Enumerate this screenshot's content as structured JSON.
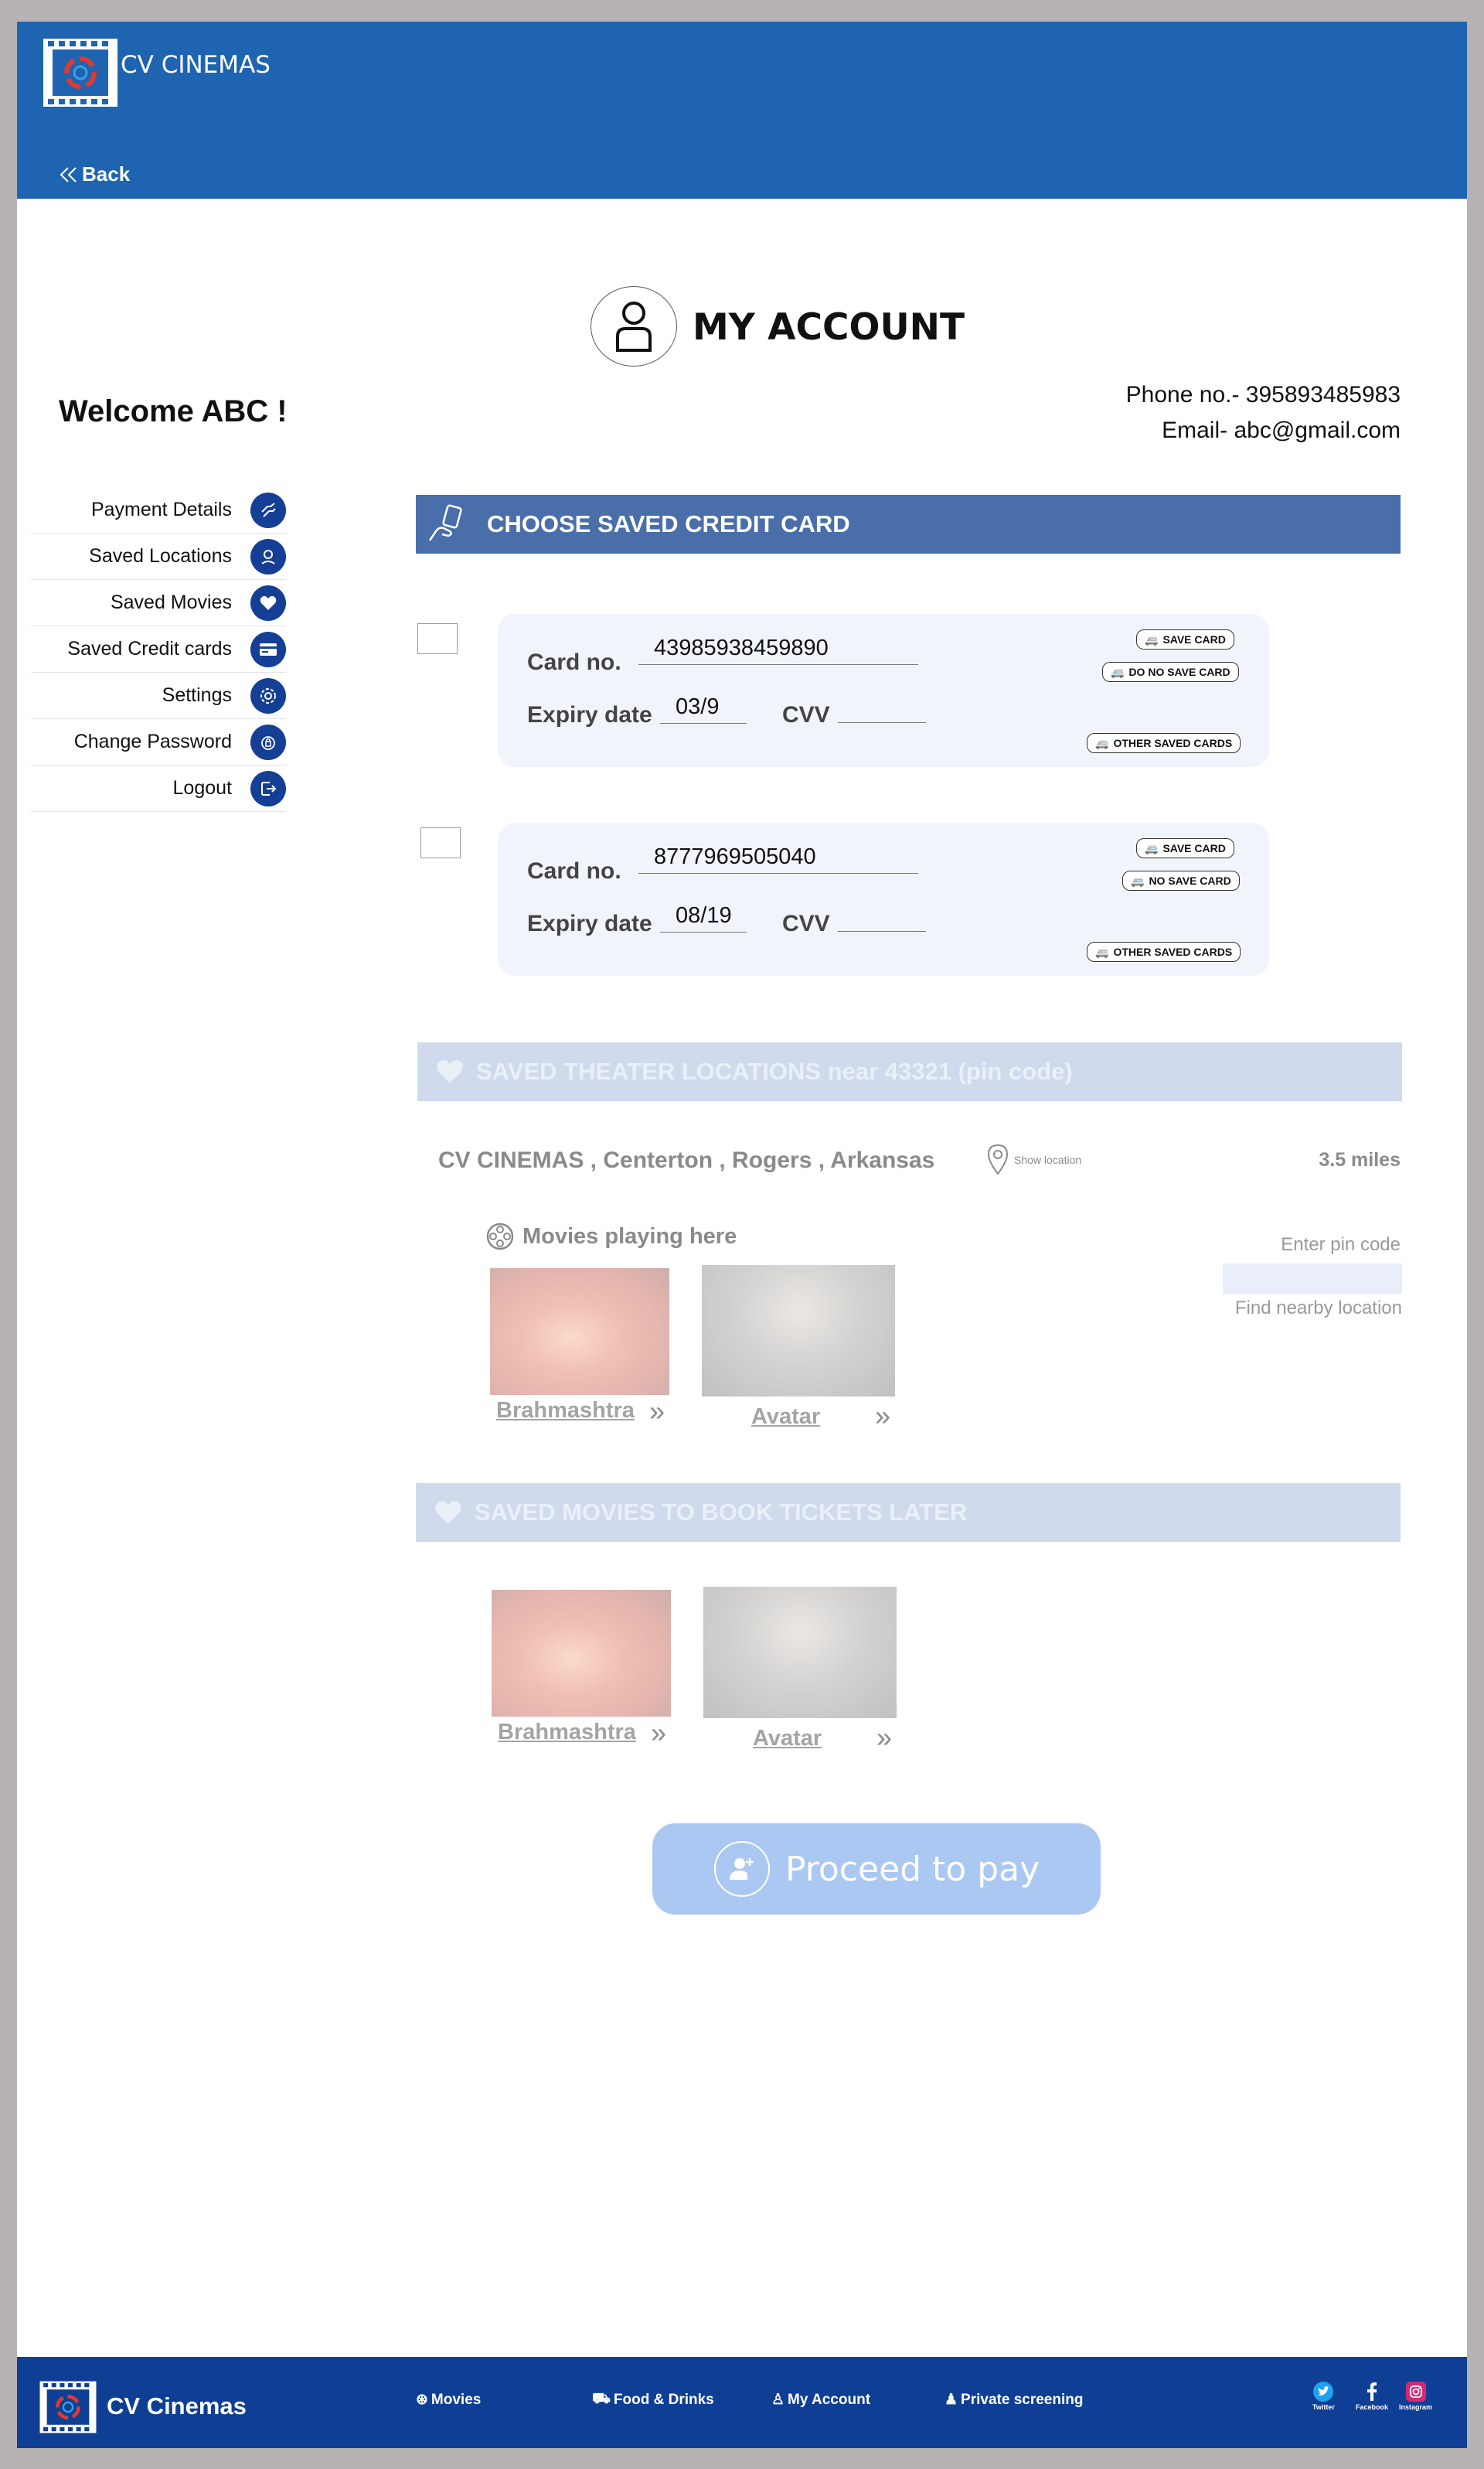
{
  "brand": "CV CINEMAS",
  "nav": {
    "back_label": "Back"
  },
  "account": {
    "title": "MY ACCOUNT",
    "welcome": "Welcome ABC !",
    "phone": "Phone no.- 395893485983",
    "email": "Email- abc@gmail.com"
  },
  "sidebar": {
    "items": [
      {
        "label": "Payment Details",
        "icon": "payment-icon"
      },
      {
        "label": "Saved Locations",
        "icon": "location-icon"
      },
      {
        "label": "Saved Movies",
        "icon": "heart-icon"
      },
      {
        "label": "Saved Credit cards",
        "icon": "credit-card-icon"
      },
      {
        "label": "Settings",
        "icon": "gear-icon"
      },
      {
        "label": "Change Password",
        "icon": "lock-icon"
      },
      {
        "label": "Logout",
        "icon": "logout-icon"
      }
    ]
  },
  "cards_section": {
    "title": "CHOOSE SAVED CREDIT CARD",
    "card_no_label": "Card no.",
    "expiry_label": "Expiry date",
    "cvv_label": "CVV",
    "cards": [
      {
        "number": "43985938459890",
        "expiry": "03/9",
        "save_label": "SAVE CARD",
        "nosave_label": "DO NO SAVE CARD",
        "other_label": "OTHER SAVED CARDS"
      },
      {
        "number": "8777969505040",
        "expiry": "08/19",
        "save_label": "SAVE CARD",
        "nosave_label": "NO SAVE CARD",
        "other_label": "OTHER SAVED CARDS"
      }
    ]
  },
  "locations_section": {
    "title": "SAVED THEATER LOCATIONS near 43321 (pin code)",
    "theater": "CV CINEMAS , Centerton , Rogers , Arkansas",
    "show_location": "Show location",
    "distance": "3.5 miles",
    "movies_playing": "Movies playing here",
    "pin_label": "Enter pin code",
    "find_nearby": "Find nearby location",
    "movies": [
      {
        "title": "Brahmashtra"
      },
      {
        "title": "Avatar"
      }
    ]
  },
  "saved_movies_section": {
    "title": "SAVED MOVIES TO BOOK TICKETS LATER",
    "movies": [
      {
        "title": "Brahmashtra"
      },
      {
        "title": "Avatar"
      }
    ]
  },
  "arrow_glyph": "»",
  "proceed_label": "Proceed to pay",
  "footer": {
    "brand": "CV Cinemas",
    "links": [
      "Movies",
      "Food & Drinks",
      "My Account",
      "Private screening"
    ],
    "social": [
      "Twitter",
      "Facebook",
      "Instagram"
    ]
  },
  "colors": {
    "header": "#1e64b1",
    "footer": "#0f3f94",
    "section_bar": "#4a6ea9",
    "accent_icon": "#143f95",
    "proceed": "#aac8f2"
  }
}
